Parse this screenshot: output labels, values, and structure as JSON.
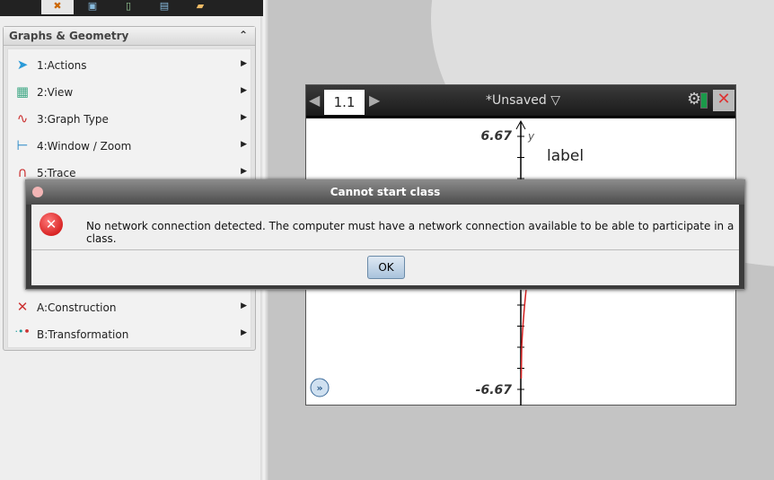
{
  "toolbar": {
    "icons": [
      "tools-icon",
      "page-sorter-icon",
      "handheld-icon",
      "documents-icon",
      "folder-icon"
    ]
  },
  "panel": {
    "title": "Graphs & Geometry",
    "items": [
      {
        "label": "1:Actions",
        "icon": "pointer-icon"
      },
      {
        "label": "2:View",
        "icon": "view-icon"
      },
      {
        "label": "3:Graph Type",
        "icon": "graph-type-icon"
      },
      {
        "label": "4:Window / Zoom",
        "icon": "window-zoom-icon"
      },
      {
        "label": "5:Trace",
        "icon": "trace-icon"
      },
      {
        "label": "A:Construction",
        "icon": "construction-icon"
      },
      {
        "label": "B:Transformation",
        "icon": "transformation-icon"
      }
    ]
  },
  "document": {
    "tab": "1.1",
    "title": "*Unsaved",
    "graph": {
      "ymax": "6.67",
      "ymin": "-6.67",
      "y_axis_label": "y",
      "text_label": "label"
    }
  },
  "dialog": {
    "title": "Cannot start class",
    "message": "No network connection detected. The computer must have a network connection available to be able to participate in a class.",
    "ok_label": "OK"
  },
  "colors": {
    "curve": "#d42020",
    "error": "#d00000"
  }
}
